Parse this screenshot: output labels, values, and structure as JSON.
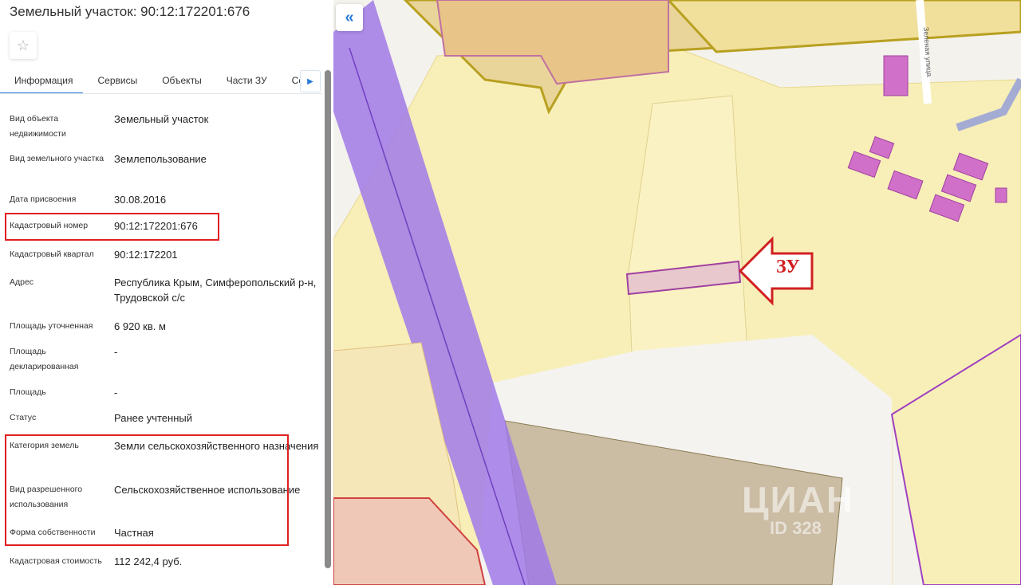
{
  "panel": {
    "title": "Земельный участок: 90:12:172201:676",
    "tabs": [
      "Информация",
      "Сервисы",
      "Объекты",
      "Части ЗУ",
      "Соста"
    ],
    "rows": [
      {
        "label": "Вид объекта недвижимости",
        "value": "Земельный участок"
      },
      {
        "label": "Вид земельного участка",
        "value": "Землепользование"
      },
      {
        "label": "Дата присвоения",
        "value": "30.08.2016"
      },
      {
        "label": "Кадастровый номер",
        "value": "90:12:172201:676"
      },
      {
        "label": "Кадастровый квартал",
        "value": "90:12:172201"
      },
      {
        "label": "Адрес",
        "value": "Республика Крым, Симферопольский р-н, Трудовской с/с"
      },
      {
        "label": "Площадь уточненная",
        "value": "6 920 кв. м"
      },
      {
        "label": "Площадь декларированная",
        "value": "-"
      },
      {
        "label": "Площадь",
        "value": "-"
      },
      {
        "label": "Статус",
        "value": "Ранее учтенный"
      },
      {
        "label": "Категория земель",
        "value": "Земли сельскохозяйственного назначения"
      },
      {
        "label": "Вид разрешенного использования",
        "value": "Сельскохозяйственное использование"
      },
      {
        "label": "Форма собственности",
        "value": "Частная"
      },
      {
        "label": "Кадастровая стоимость",
        "value": "112 242,4 руб."
      }
    ]
  },
  "map": {
    "annotation": "ЗУ",
    "street": "Зеленая улица",
    "watermark": "ЦИАН",
    "watermark_id": "ID 328",
    "highlight_color": "#e02020",
    "parcel_color": "#e8c8cc"
  }
}
